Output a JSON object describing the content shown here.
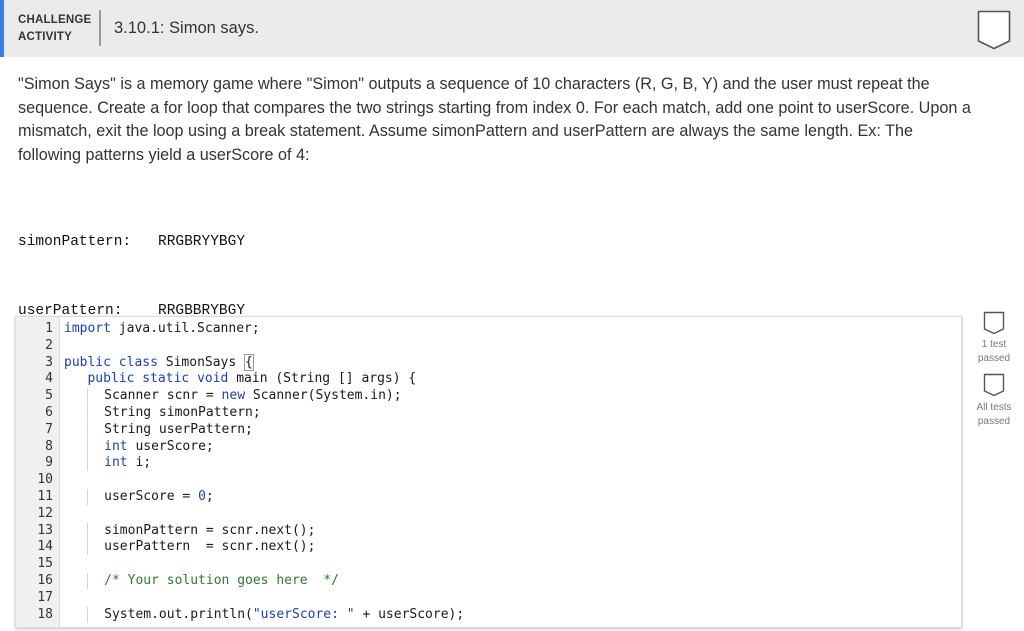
{
  "header": {
    "activity_type_line1": "CHALLENGE",
    "activity_type_line2": "ACTIVITY",
    "title": "3.10.1: Simon says.",
    "completion_icon": "shield-outline-icon"
  },
  "description": "\"Simon Says\" is a memory game where \"Simon\" outputs a sequence of 10 characters (R, G, B, Y) and the user must repeat the sequence. Create a for loop that compares the two strings starting from index 0. For each match, add one point to userScore. Upon a mismatch, exit the loop using a break statement. Assume simonPattern and userPattern are always the same length. Ex: The following patterns yield a userScore of 4:",
  "example": {
    "simon_label": "simonPattern:",
    "simon_value": "RRGBRYYBGY",
    "user_label": "userPattern:",
    "user_value": "RRGBBRYBGY"
  },
  "code_lines": [
    "import java.util.Scanner;",
    "",
    "public class SimonSays {",
    "   public static void main (String [] args) {",
    "      Scanner scnr = new Scanner(System.in);",
    "      String simonPattern;",
    "      String userPattern;",
    "      int userScore;",
    "      int i;",
    "",
    "      userScore = 0;",
    "",
    "      simonPattern = scnr.next();",
    "      userPattern  = scnr.next();",
    "",
    "      /* Your solution goes here  */",
    "",
    "      System.out.println(\"userScore: \" + userScore);"
  ],
  "line_numbers": [
    "1",
    "2",
    "3",
    "4",
    "5",
    "6",
    "7",
    "8",
    "9",
    "10",
    "11",
    "12",
    "13",
    "14",
    "15",
    "16",
    "17",
    "18"
  ],
  "tests": [
    {
      "label_line1": "1 test",
      "label_line2": "passed",
      "icon": "shield-outline-icon"
    },
    {
      "label_line1": "All tests",
      "label_line2": "passed",
      "icon": "shield-outline-icon"
    }
  ],
  "colors": {
    "accent": "#3f7ee0",
    "keyword": "#1d3fb0",
    "comment": "#2e7a2e",
    "header_bg": "#ebebeb"
  }
}
